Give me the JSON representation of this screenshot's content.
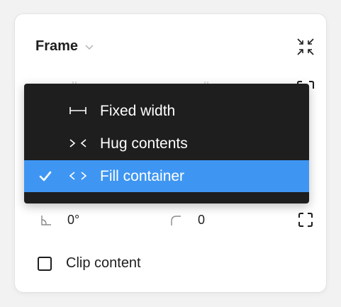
{
  "panel": {
    "title": "Frame",
    "title_chevron_icon": "chevron-down-icon",
    "collapse_icon": "collapse-arrows-icon"
  },
  "dropdown": {
    "items": [
      {
        "label": "Fixed width",
        "icon": "fixed-width-icon",
        "selected": false
      },
      {
        "label": "Hug contents",
        "icon": "hug-contents-icon",
        "selected": false
      },
      {
        "label": "Fill container",
        "icon": "fill-container-icon",
        "selected": true
      }
    ],
    "background": "#1e1e1e",
    "selected_color": "#3f96f2"
  },
  "rotation": {
    "icon": "rotation-angle-icon",
    "value": "0°"
  },
  "corner_radius": {
    "icon": "corner-radius-icon",
    "value": "0"
  },
  "independent_corners_icon": "independent-corners-icon",
  "clip_content": {
    "label": "Clip content",
    "checked": false
  }
}
